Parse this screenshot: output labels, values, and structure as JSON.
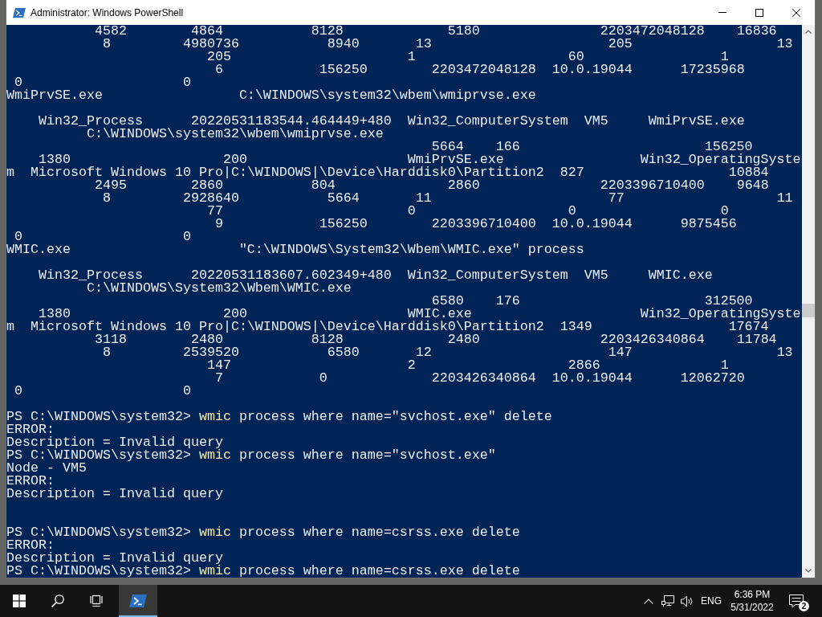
{
  "window": {
    "title": "Administrator: Windows PowerShell"
  },
  "console": {
    "lines": [
      {
        "kind": "output",
        "text": "           4582        4864           8128             5180               2203472048128    16836"
      },
      {
        "kind": "output",
        "text": "            8         4980736           8940       13                      205                  13"
      },
      {
        "kind": "output",
        "text": "                         205                      1                   60                 1"
      },
      {
        "kind": "output",
        "text": "                          6            156250        2203472048128  10.0.19044      17235968"
      },
      {
        "kind": "output",
        "text": " 0                    0"
      },
      {
        "kind": "output",
        "text": "WmiPrvSE.exe                 C:\\WINDOWS\\system32\\wbem\\wmiprvse.exe"
      },
      {
        "kind": "blank"
      },
      {
        "kind": "output",
        "text": "    Win32_Process      20220531183544.464449+480  Win32_ComputerSystem  VM5     WmiPrvSE.exe"
      },
      {
        "kind": "output",
        "text": "          C:\\WINDOWS\\system32\\wbem\\wmiprvse.exe"
      },
      {
        "kind": "output",
        "text": "                                                     5664    166                       156250"
      },
      {
        "kind": "output",
        "text": "    1380                   200                    WmiPrvSE.exe                 Win32_OperatingSyste"
      },
      {
        "kind": "output",
        "text": "m  Microsoft Windows 10 Pro|C:\\WINDOWS|\\Device\\Harddisk0\\Partition2  827                  10884"
      },
      {
        "kind": "output",
        "text": "           2495        2860           804              2860               2203396710400    9648"
      },
      {
        "kind": "output",
        "text": "            8         2928640           5664       11                      77                   11"
      },
      {
        "kind": "output",
        "text": "                         77                       0                   0                  0"
      },
      {
        "kind": "output",
        "text": "                          9            156250        2203396710400  10.0.19044      9875456"
      },
      {
        "kind": "output",
        "text": " 0                    0"
      },
      {
        "kind": "output",
        "text": "WMIC.exe                     \"C:\\WINDOWS\\System32\\Wbem\\WMIC.exe\" process"
      },
      {
        "kind": "blank"
      },
      {
        "kind": "output",
        "text": "    Win32_Process      20220531183607.602349+480  Win32_ComputerSystem  VM5     WMIC.exe"
      },
      {
        "kind": "output",
        "text": "          C:\\WINDOWS\\System32\\Wbem\\WMIC.exe"
      },
      {
        "kind": "output",
        "text": "                                                     6580    176                       312500"
      },
      {
        "kind": "output",
        "text": "    1380                   200                    WMIC.exe                     Win32_OperatingSyste"
      },
      {
        "kind": "output",
        "text": "m  Microsoft Windows 10 Pro|C:\\WINDOWS|\\Device\\Harddisk0\\Partition2  1349                 17674"
      },
      {
        "kind": "output",
        "text": "           3118        2480           8128             2480               2203426340864    11784"
      },
      {
        "kind": "output",
        "text": "            8         2539520           6580       12                      147                  13"
      },
      {
        "kind": "output",
        "text": "                         147                      2                   2866               1"
      },
      {
        "kind": "output",
        "text": "                          7            0             2203426340864  10.0.19044      12062720"
      },
      {
        "kind": "output",
        "text": " 0                    0"
      },
      {
        "kind": "blank"
      },
      {
        "kind": "prompt",
        "prompt": "PS C:\\WINDOWS\\system32>",
        "command": "wmic",
        "args": "process where name=\"svchost.exe\" delete"
      },
      {
        "kind": "output",
        "text": "ERROR:"
      },
      {
        "kind": "output",
        "text": "Description = Invalid query"
      },
      {
        "kind": "prompt",
        "prompt": "PS C:\\WINDOWS\\system32>",
        "command": "wmic",
        "args": "process where name=\"svchost.exe\""
      },
      {
        "kind": "output",
        "text": "Node - VM5"
      },
      {
        "kind": "output",
        "text": "ERROR:"
      },
      {
        "kind": "output",
        "text": "Description = Invalid query"
      },
      {
        "kind": "blank"
      },
      {
        "kind": "blank"
      },
      {
        "kind": "prompt",
        "prompt": "PS C:\\WINDOWS\\system32>",
        "command": "wmic",
        "args": "process where name=csrss.exe delete"
      },
      {
        "kind": "output",
        "text": "ERROR:"
      },
      {
        "kind": "output",
        "text": "Description = Invalid query"
      },
      {
        "kind": "prompt",
        "prompt": "PS C:\\WINDOWS\\system32>",
        "command": "wmic",
        "args": "process where name=csrss.exe delete"
      }
    ]
  },
  "taskbar": {
    "running_apps": [
      {
        "selected": true
      }
    ],
    "tray": {
      "language": "ENG",
      "time": "6:36 PM",
      "date": "5/31/2022",
      "notification_count": "2"
    }
  }
}
